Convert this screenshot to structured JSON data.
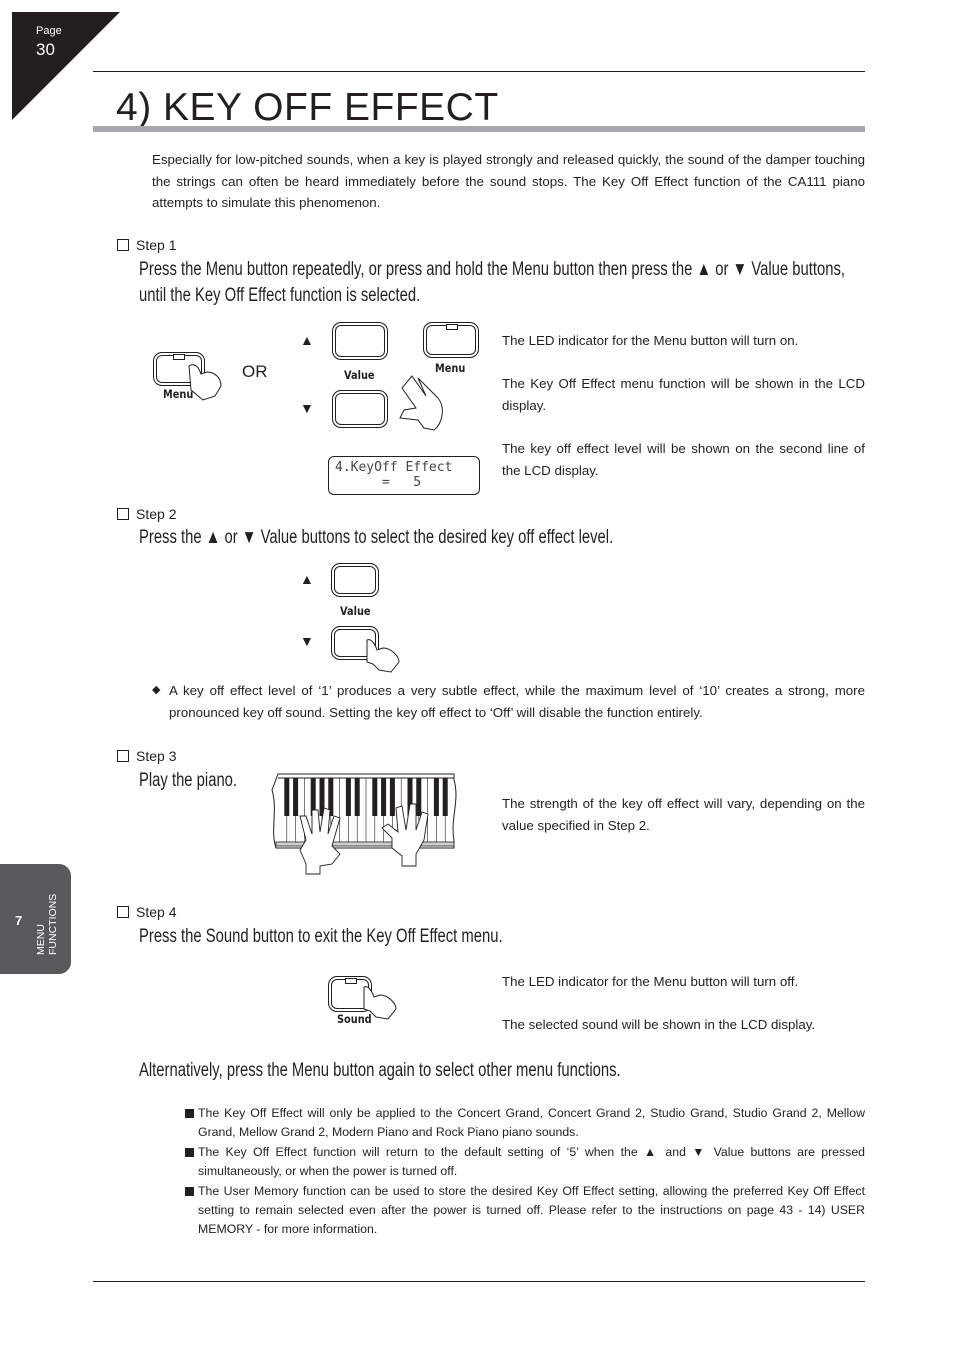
{
  "page": {
    "label": "Page",
    "number": "30"
  },
  "title": "4) KEY OFF EFFECT",
  "intro": "Especially for low-pitched sounds, when a key is played strongly and released quickly, the sound of the damper touching the strings can often be heard immediately before the sound stops.  The Key Off Effect function of the CA111 piano attempts to simulate this phenomenon.",
  "side_tab": {
    "chapter": "7",
    "line1": "MENU",
    "line2": "FUNCTIONS"
  },
  "step1": {
    "label": "Step 1",
    "instruction_line1": "Press the Menu button repeatedly, or press and hold the Menu button then press the ▲ or ▼ Value buttons,",
    "instruction_line2": "until the Key Off Effect function is selected.",
    "or_label": "OR",
    "menu_caption": "Menu",
    "value_caption": "Value",
    "up_arrow": "▲",
    "down_arrow": "▼",
    "lcd_line1": "4.KeyOff Effect",
    "lcd_line2": "      =   5",
    "notes": [
      "The LED indicator for the Menu button will turn on.",
      "The Key Off Effect menu function will be shown in the LCD display.",
      "The key off effect level will be shown on the second line of the LCD display."
    ]
  },
  "step2": {
    "label": "Step 2",
    "instruction": "Press the ▲ or ▼ Value buttons to select the desired key off effect level.",
    "value_caption": "Value",
    "up_arrow": "▲",
    "down_arrow": "▼",
    "bullet_icon": "◆",
    "bullet": "A key off effect level of ‘1’ produces a very subtle effect, while the maximum level of ‘10’ creates a strong, more pronounced key off sound.  Setting the key off effect to ‘Off’ will disable the function entirely."
  },
  "step3": {
    "label": "Step 3",
    "instruction": "Play the piano.",
    "note": "The strength of the key off effect will vary, depending on the value specified in Step 2."
  },
  "step4": {
    "label": "Step 4",
    "instruction": "Press the Sound button to exit the Key Off Effect menu.",
    "sound_caption": "Sound",
    "notes": [
      "The LED indicator for the Menu button will turn off.",
      "The selected sound will be shown in the LCD display."
    ],
    "alternative": "Alternatively, press the Menu button again to select other menu functions."
  },
  "footnotes": [
    "The Key Off Effect will only be applied to the Concert Grand, Concert Grand 2, Studio Grand, Studio Grand 2, Mellow Grand, Mellow Grand 2, Modern Piano and Rock Piano piano sounds.",
    "The Key Off Effect function will return to the default setting of ‘5’ when the ▲ and ▼ Value buttons are pressed simultaneously, or when the power is turned off.",
    "The User Memory function can be used to store the desired Key Off Effect setting, allowing the preferred Key Off Effect setting to remain selected even after the power is turned off.  Please refer to the instructions on page 43 - 14) USER MEMORY - for more information."
  ]
}
